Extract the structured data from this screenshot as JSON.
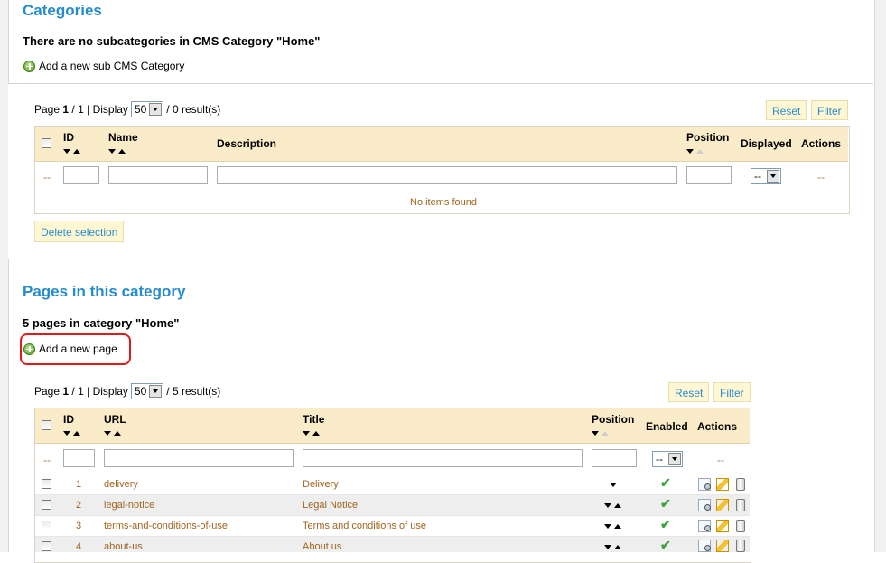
{
  "categories_section": {
    "title": "Categories",
    "no_subcategories_text": "There are no subcategories in CMS Category \"Home\"",
    "add_link_label": "Add a new sub CMS Category",
    "pagination": {
      "page_label": "Page",
      "page": "1",
      "separator": "/",
      "total_pages": "1",
      "display_label": "| Display",
      "per_page": "50",
      "results": "/ 0 result(s)"
    },
    "reset_button": "Reset",
    "filter_button": "Filter",
    "columns": {
      "id": "ID",
      "name": "Name",
      "description": "Description",
      "position": "Position",
      "displayed": "Displayed",
      "actions": "Actions"
    },
    "filter_row": {
      "dash": "--",
      "displayed_select": "--",
      "actions_dash": "--"
    },
    "empty_message": "No items found",
    "delete_button": "Delete selection"
  },
  "pages_section": {
    "title": "Pages in this category",
    "count_text": "5 pages in category \"Home\"",
    "add_link_label": "Add a new page",
    "pagination": {
      "page_label": "Page",
      "page": "1",
      "separator": "/",
      "total_pages": "1",
      "display_label": "| Display",
      "per_page": "50",
      "results": "/ 5 result(s)"
    },
    "reset_button": "Reset",
    "filter_button": "Filter",
    "columns": {
      "id": "ID",
      "url": "URL",
      "title": "Title",
      "position": "Position",
      "enabled": "Enabled",
      "actions": "Actions"
    },
    "filter_row": {
      "dash": "--",
      "enabled_select": "--",
      "actions_dash": "--"
    },
    "rows": [
      {
        "id": "1",
        "url": "delivery",
        "title": "Delivery"
      },
      {
        "id": "2",
        "url": "legal-notice",
        "title": "Legal Notice"
      },
      {
        "id": "3",
        "url": "terms-and-conditions-of-use",
        "title": "Terms and conditions of use"
      },
      {
        "id": "4",
        "url": "about-us",
        "title": "About us"
      }
    ]
  },
  "colors": {
    "heading": "#268ccd",
    "header_bg": "#fbecc9",
    "link": "#a0641f",
    "highlight": "#e01a1a",
    "enabled_check": "#3ea43a"
  },
  "icons": [
    "add-icon",
    "view-icon",
    "edit-icon",
    "delete-icon",
    "enabled-check-icon",
    "sort-down-icon",
    "sort-up-icon"
  ]
}
